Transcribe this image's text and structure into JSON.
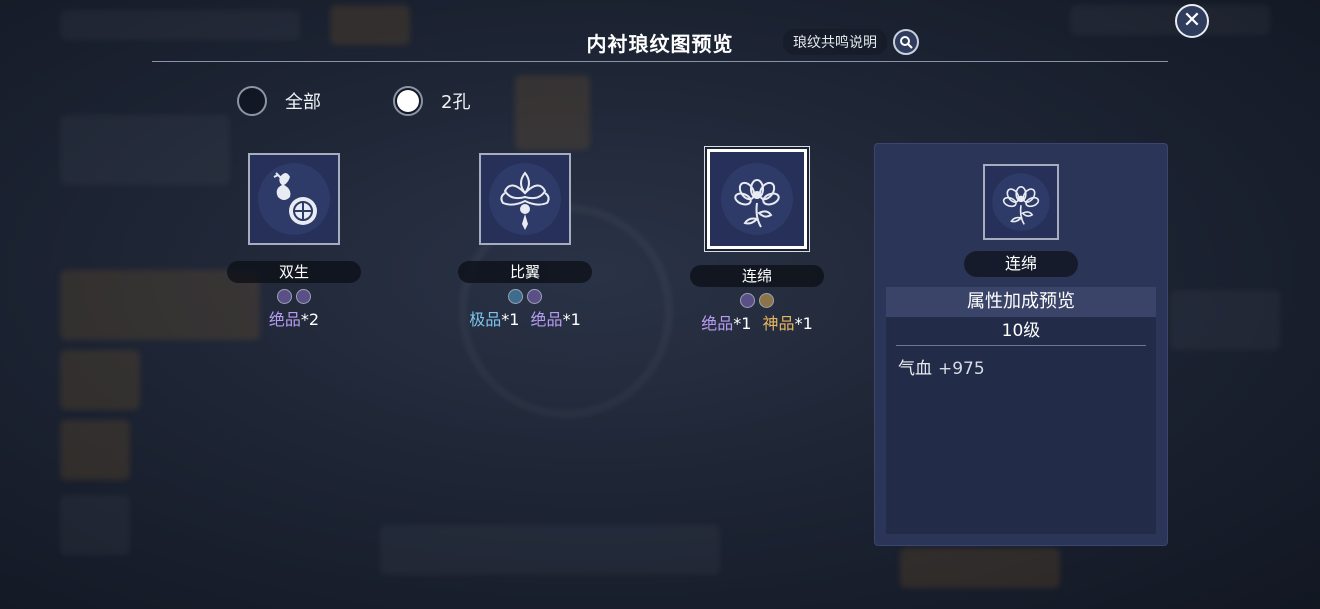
{
  "header": {
    "title": "内衬琅纹图预览",
    "help_label": "琅纹共鸣说明",
    "close_label": "✕"
  },
  "filters": [
    {
      "label": "全部",
      "selected": false
    },
    {
      "label": "2孔",
      "selected": true
    }
  ],
  "cards": [
    {
      "name": "双生",
      "icon": "gourd-coin-icon",
      "gems": [
        "#5a4f86",
        "#5a4f86"
      ],
      "grades": [
        {
          "text": "绝品",
          "count": "*2",
          "color": "#b89cf2"
        }
      ]
    },
    {
      "name": "比翼",
      "icon": "lotus-icon",
      "gems": [
        "#3d6c8c",
        "#5a4f86"
      ],
      "grades": [
        {
          "text": "极品",
          "count": "*1",
          "color": "#7cc4ee"
        },
        {
          "text": "绝品",
          "count": "*1",
          "color": "#b89cf2"
        }
      ]
    },
    {
      "name": "连绵",
      "icon": "peony-icon",
      "gems": [
        "#5a4f86",
        "#8a7448"
      ],
      "grades": [
        {
          "text": "绝品",
          "count": "*1",
          "color": "#b89cf2"
        },
        {
          "text": "神品",
          "count": "*1",
          "color": "#e8b560"
        }
      ]
    }
  ],
  "detail": {
    "name": "连绵",
    "icon": "peony-icon",
    "section_title": "属性加成预览",
    "level": "10级",
    "stats": [
      {
        "label": "气血",
        "value": "+975"
      }
    ]
  }
}
